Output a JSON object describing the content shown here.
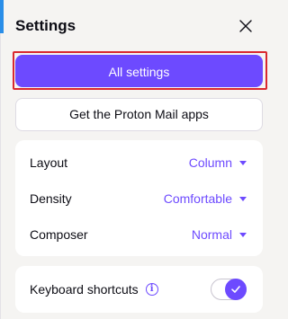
{
  "panel": {
    "title": "Settings",
    "close_icon": "close-icon"
  },
  "actions": {
    "all_settings_label": "All settings",
    "get_apps_label": "Get the Proton Mail apps"
  },
  "options": [
    {
      "label": "Layout",
      "value": "Column"
    },
    {
      "label": "Density",
      "value": "Comfortable"
    },
    {
      "label": "Composer",
      "value": "Normal"
    }
  ],
  "keyboard_shortcuts": {
    "label": "Keyboard shortcuts",
    "info_icon": "info-icon",
    "enabled": true
  },
  "colors": {
    "accent": "#6d4aff",
    "highlight_outline": "#d9282f",
    "background": "#f5f4f2"
  }
}
